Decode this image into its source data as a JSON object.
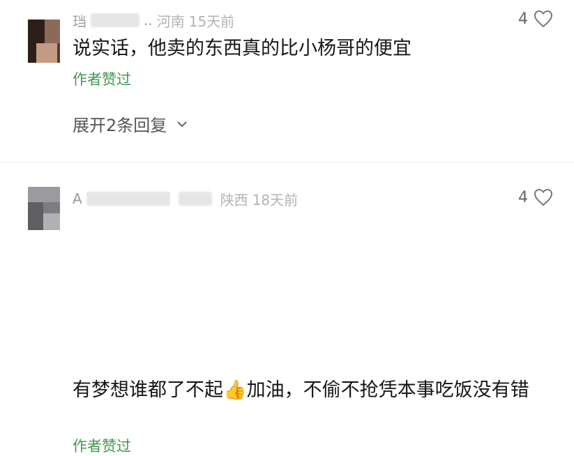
{
  "comments": [
    {
      "username": "珰",
      "username_tail": "..",
      "location": "河南",
      "time": "15天前",
      "text": "说实话，他卖的东西真的比小杨哥的便宜",
      "author_liked": "作者赞过",
      "like_count": "4",
      "expand_replies": "展开2条回复"
    },
    {
      "username": "A",
      "username_tail": "",
      "location": "陕西",
      "time": "18天前",
      "text_before_emoji": "有梦想谁都了不起",
      "emoji": "👍",
      "text_after_emoji": "加油，不偷不抢凭本事吃饭没有错",
      "author_liked": "作者赞过",
      "like_count": "4"
    }
  ],
  "icons": {
    "like": "heart-outline-icon",
    "expand": "chevron-down-icon"
  }
}
